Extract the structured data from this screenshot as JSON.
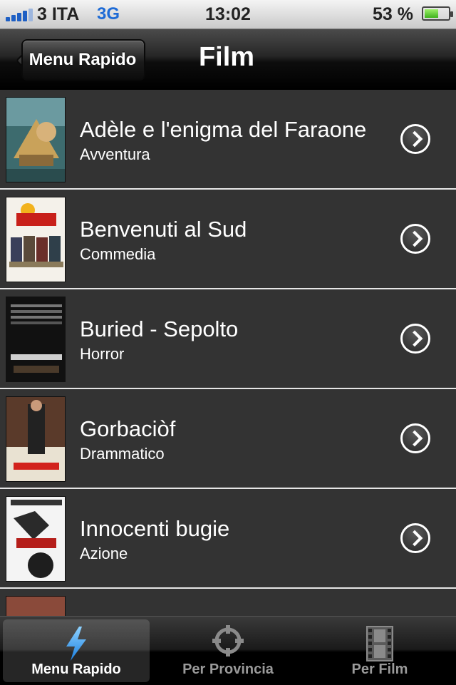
{
  "status_bar": {
    "carrier": "3 ITA",
    "network": "3G",
    "time": "13:02",
    "battery": "53 %",
    "battery_level": 0.53
  },
  "navbar": {
    "back_label": "Menu Rapido",
    "title": "Film"
  },
  "films": [
    {
      "title": "Adèle e l'enigma del Faraone",
      "genre": "Avventura"
    },
    {
      "title": "Benvenuti al Sud",
      "genre": "Commedia"
    },
    {
      "title": "Buried - Sepolto",
      "genre": "Horror"
    },
    {
      "title": "Gorbaciòf",
      "genre": "Drammatico"
    },
    {
      "title": "Innocenti bugie",
      "genre": "Azione"
    }
  ],
  "tabs": [
    {
      "label": "Menu Rapido",
      "icon": "lightning-icon",
      "active": true
    },
    {
      "label": "Per Provincia",
      "icon": "crosshair-icon",
      "active": false
    },
    {
      "label": "Per Film",
      "icon": "film-strip-icon",
      "active": false
    }
  ],
  "colors": {
    "accent_blue": "#1e6bd6",
    "row_background": "#333333",
    "separator": "#e6e6e6"
  }
}
